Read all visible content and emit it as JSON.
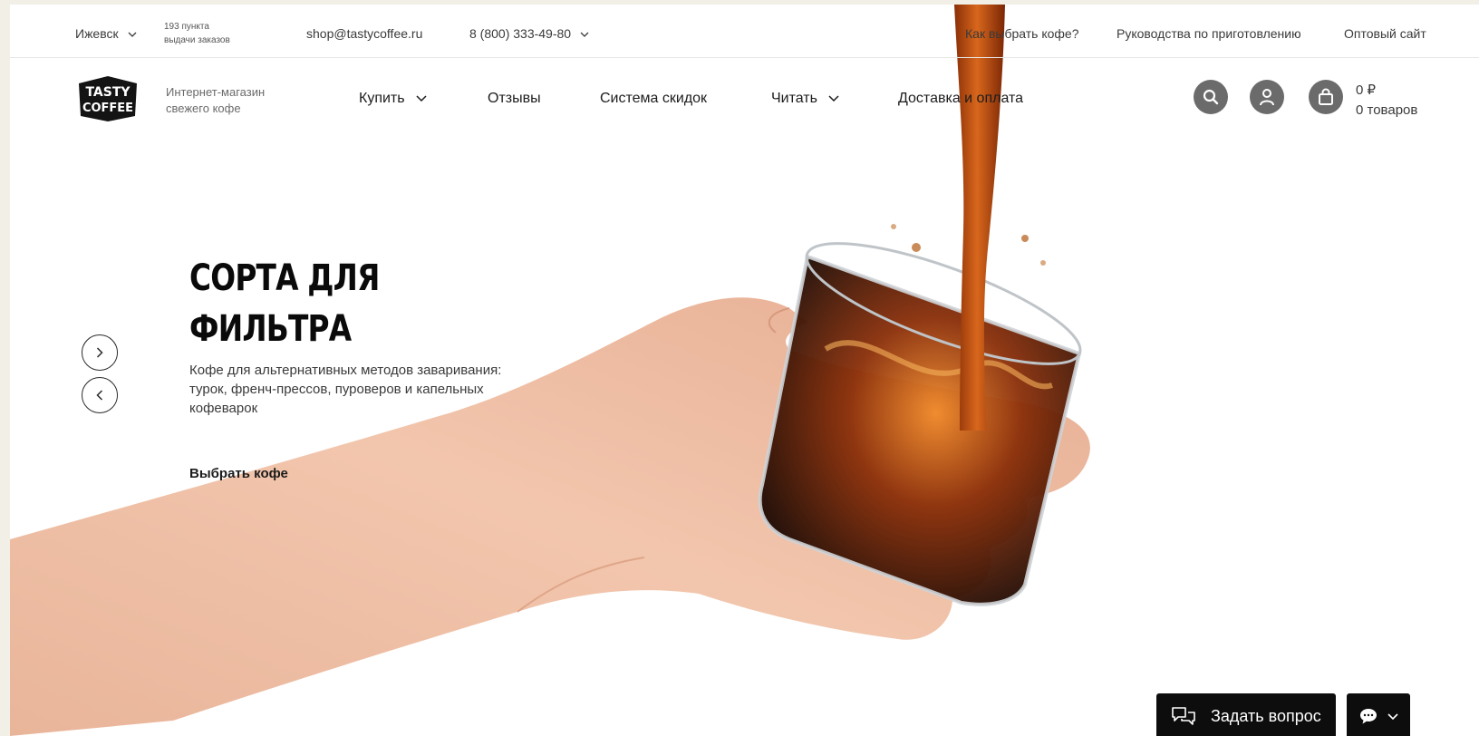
{
  "topbar": {
    "city": "Ижевск",
    "pickup_line1": "193 пункта",
    "pickup_line2": "выдачи заказов",
    "email": "shop@tastycoffee.ru",
    "phone": "8 (800) 333-49-80",
    "links": [
      "Как выбрать кофе?",
      "Руководства по приготовлению",
      "Оптовый сайт"
    ]
  },
  "header": {
    "logo_text_top": "TASTY",
    "logo_text_bottom": "COFFEE",
    "tagline_line1": "Интернет-магазин",
    "tagline_line2": "свежего кофе",
    "nav": [
      "Купить",
      "Отзывы",
      "Система скидок",
      "Читать",
      "Доставка и оплата"
    ],
    "cart_amount": "0 ₽",
    "cart_count": "0 товаров"
  },
  "hero": {
    "title_line1": "СОРТА ДЛЯ",
    "title_line2": "ФИЛЬТРА",
    "subtitle": "Кофе для альтернативных методов заваривания: турок, френч-прессов, пуроверов и капельных кофеварок",
    "cta": "Выбрать кофе"
  },
  "widgets": {
    "ask_label": "Задать вопрос"
  },
  "icons": {
    "search": "search-icon",
    "account": "user-icon",
    "cart": "bag-icon",
    "next": "chevron-right-icon",
    "prev": "chevron-left-icon",
    "chat": "chat-bubble-icon"
  },
  "colors": {
    "icon_circle": "#6b6b6b",
    "coffee": "#7a2e0a",
    "widget_bg": "#0d0d0d",
    "page_bg": "#f2efe6"
  }
}
